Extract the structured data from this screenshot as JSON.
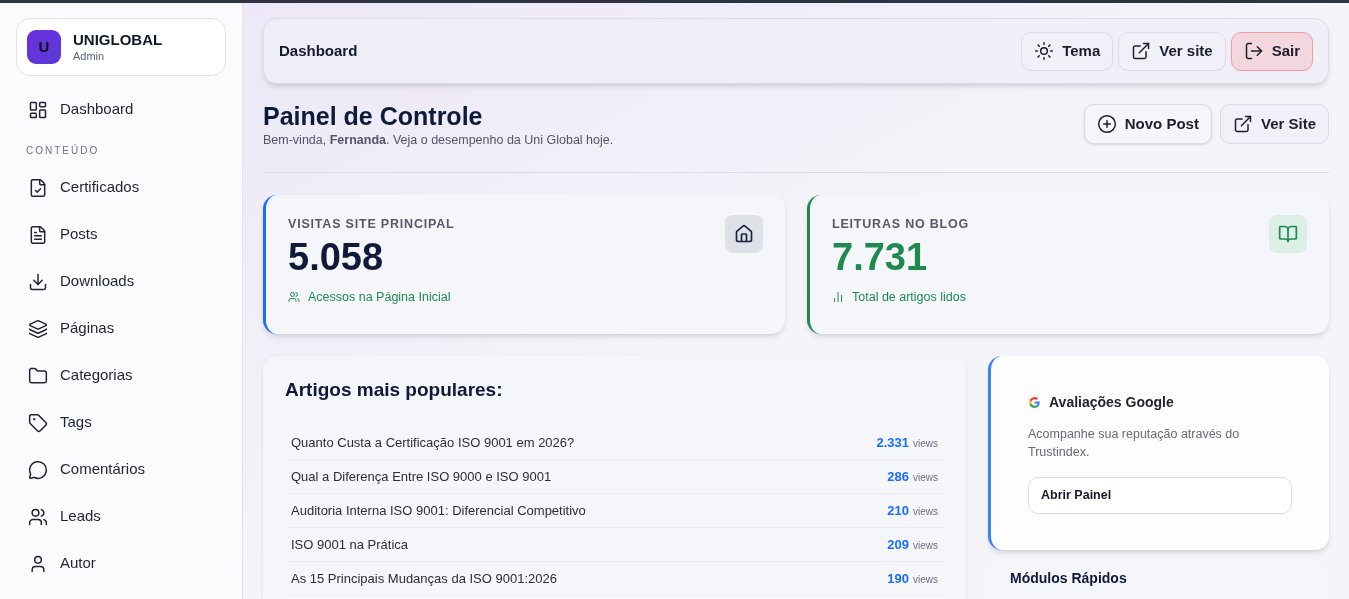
{
  "brand": {
    "initial": "U",
    "name": "UNIGLOBAL",
    "role": "Admin"
  },
  "sidebar": {
    "top": [
      {
        "label": "Dashboard"
      }
    ],
    "section": "CONTEÚDO",
    "items": [
      {
        "label": "Certificados"
      },
      {
        "label": "Posts"
      },
      {
        "label": "Downloads"
      },
      {
        "label": "Páginas"
      },
      {
        "label": "Categorias"
      },
      {
        "label": "Tags"
      },
      {
        "label": "Comentários"
      },
      {
        "label": "Leads"
      },
      {
        "label": "Autor"
      }
    ]
  },
  "topbar": {
    "title": "Dashboard",
    "buttons": [
      {
        "label": "Tema",
        "kind": "theme"
      },
      {
        "label": "Ver site",
        "kind": "external"
      },
      {
        "label": "Sair",
        "kind": "danger"
      }
    ]
  },
  "header": {
    "title": "Painel de Controle",
    "subtitle": "Bem-vinda, **Fernanda**. Veja o desempenho da Uni Global hoje.",
    "buttons": [
      {
        "label": "Novo Post",
        "kind": "add"
      },
      {
        "label": "Ver Site",
        "kind": "external"
      }
    ]
  },
  "stats": [
    {
      "label": "VISITAS SITE PRINCIPAL",
      "value": "5.058",
      "note": "Acessos na Página Inicial",
      "color": "#1a6dff"
    },
    {
      "label": "LEITURAS NO BLOG",
      "value": "7.731",
      "note": "Total de artigos lidos",
      "color": "#1e8a50"
    }
  ],
  "popular": {
    "title": "Artigos mais populares:",
    "rows": [
      {
        "title": "Quanto Custa a Certificação ISO 9001 em 2026?",
        "count": "2.331",
        "unit": "views"
      },
      {
        "title": "Qual a Diferença Entre ISO 9000 e ISO 9001",
        "count": "286",
        "unit": "views"
      },
      {
        "title": "Auditoria Interna ISO 9001: Diferencial Competitivo",
        "count": "210",
        "unit": "views"
      },
      {
        "title": "ISO 9001 na Prática",
        "count": "209",
        "unit": "views"
      },
      {
        "title": "As 15 Principais Mudanças da ISO 9001:2026",
        "count": "190",
        "unit": "views"
      }
    ]
  },
  "reviews": {
    "title": "Avaliações Google",
    "text": "Acompanhe sua reputação através do Trustindex.",
    "button": "Abrir Painel"
  },
  "modules": {
    "title": "Módulos Rápidos"
  }
}
